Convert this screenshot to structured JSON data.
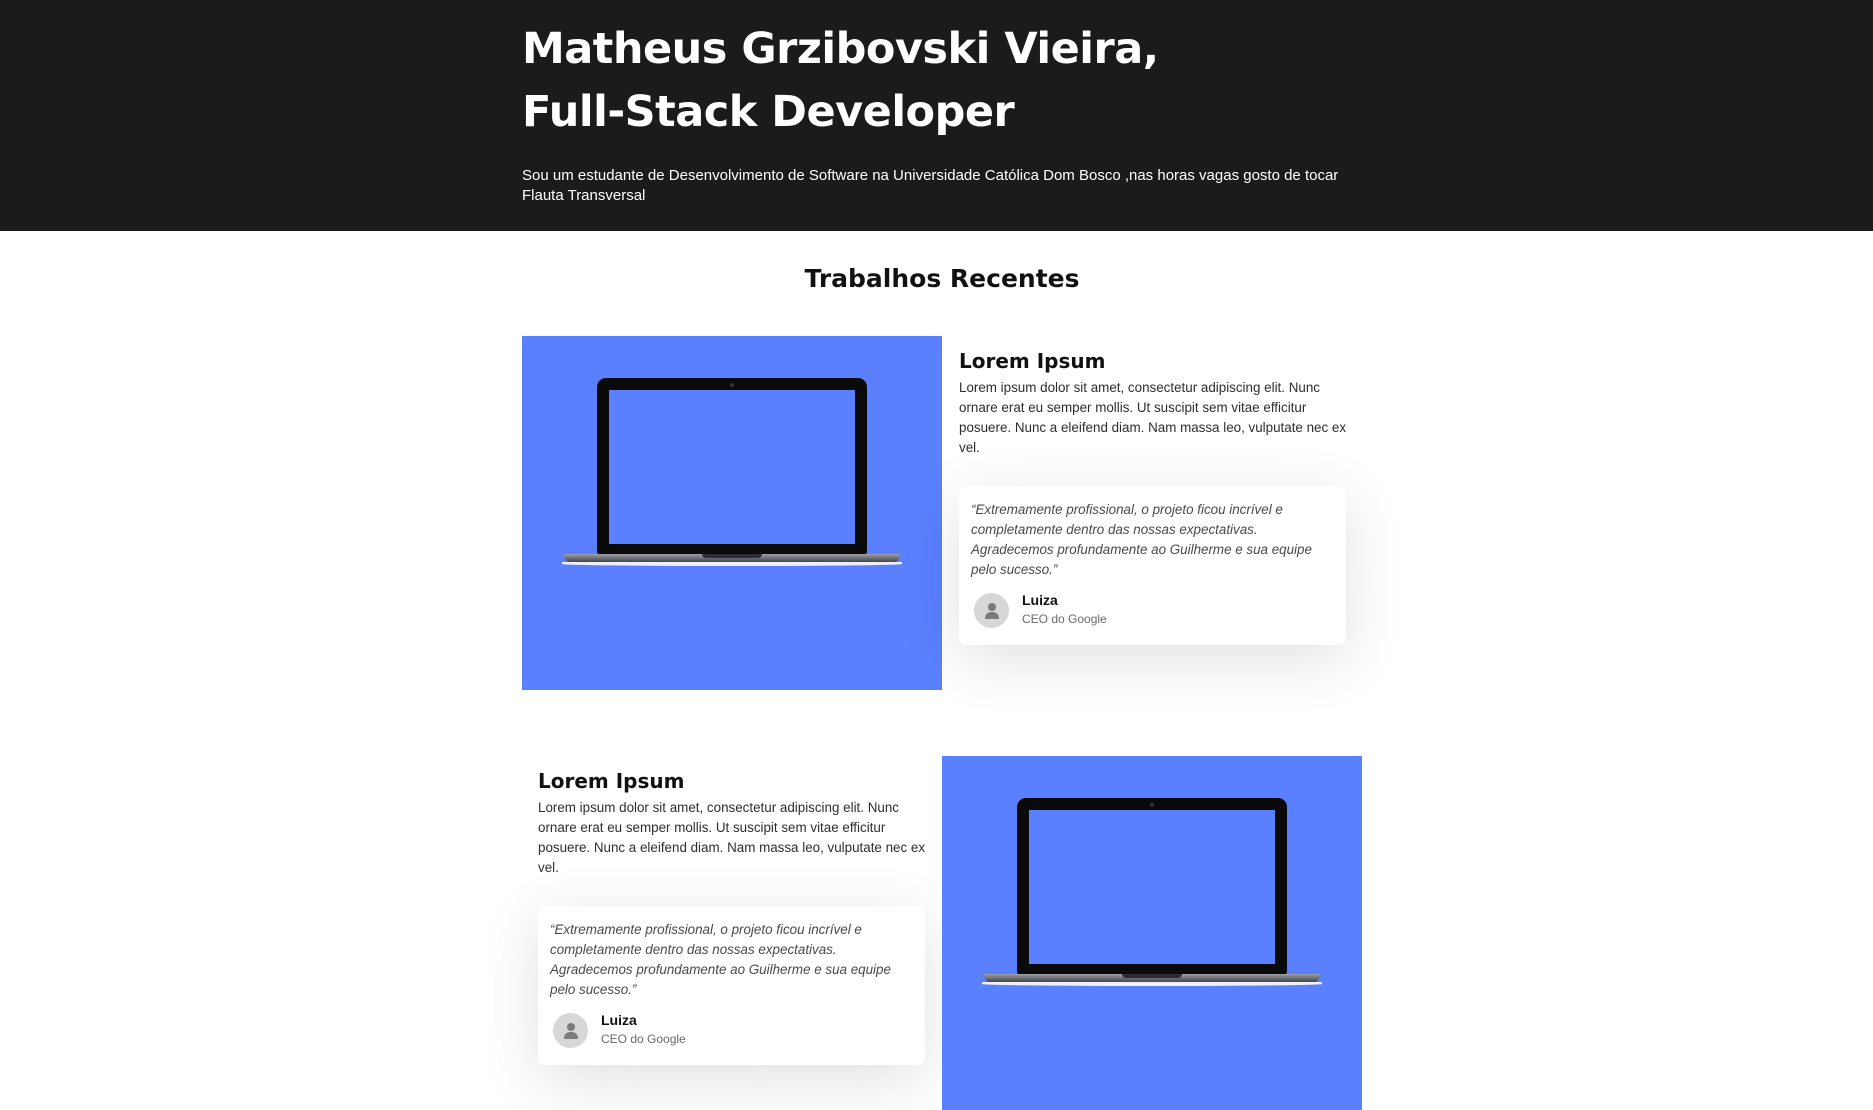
{
  "hero": {
    "title_line1": "Matheus Grzibovski Vieira,",
    "title_line2": "Full-Stack Developer",
    "description": "Sou um estudante de Desenvolvimento de Software na Universidade Católica Dom Bosco ,nas horas vagas gosto de tocar Flauta Transversal"
  },
  "section": {
    "title": "Trabalhos Recentes"
  },
  "projects": [
    {
      "title": "Lorem Ipsum",
      "description": "Lorem ipsum dolor sit amet, consectetur adipiscing elit. Nunc ornare erat eu semper mollis. Ut suscipit sem vitae efficitur posuere. Nunc a eleifend diam. Nam massa leo, vulputate nec ex vel.",
      "testimonial": {
        "quote": "“Extremamente profissional, o projeto ficou incrível e completamente dentro das nossas expectativas. Agradecemos profundamente ao Guilherme e sua equipe pelo sucesso.”",
        "author": "Luiza",
        "role": "CEO do Google"
      }
    },
    {
      "title": "Lorem Ipsum",
      "description": "Lorem ipsum dolor sit amet, consectetur adipiscing elit. Nunc ornare erat eu semper mollis. Ut suscipit sem vitae efficitur posuere. Nunc a eleifend diam. Nam massa leo, vulputate nec ex vel.",
      "testimonial": {
        "quote": "“Extremamente profissional, o projeto ficou incrível e completamente dentro das nossas expectativas. Agradecemos profundamente ao Guilherme e sua equipe pelo sucesso.”",
        "author": "Luiza",
        "role": "CEO do Google"
      }
    }
  ],
  "colors": {
    "hero_background": "#1b1b1b",
    "project_image_background": "#5b80ff",
    "page_background": "#ffffff"
  },
  "icons": {
    "project_image": "laptop-icon",
    "avatar": "user-avatar-icon"
  }
}
